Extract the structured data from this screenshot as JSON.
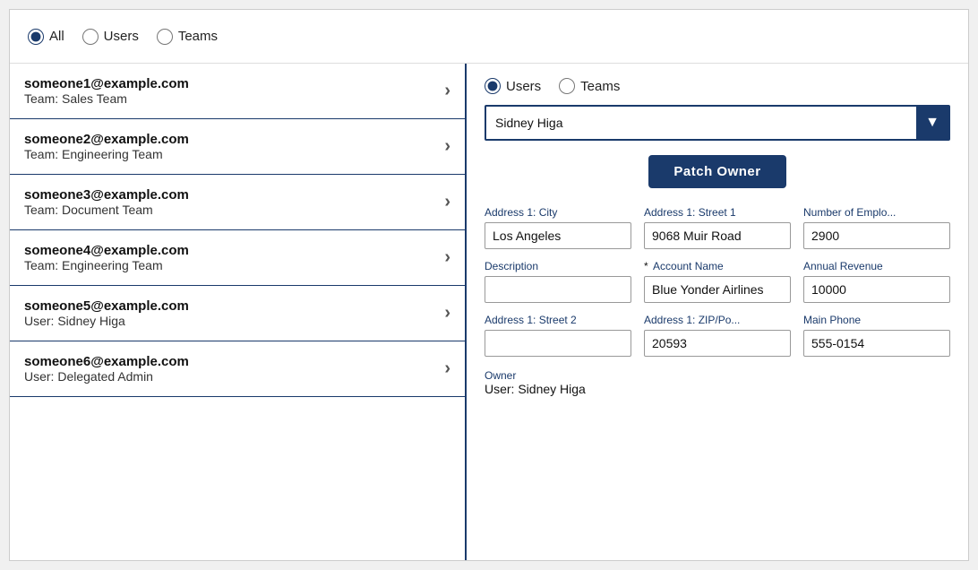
{
  "top_bar": {
    "filter_options": [
      "All",
      "Users",
      "Teams"
    ],
    "selected_filter": "All"
  },
  "list": {
    "items": [
      {
        "email": "someone1@example.com",
        "team": "Team: Sales Team"
      },
      {
        "email": "someone2@example.com",
        "team": "Team: Engineering Team"
      },
      {
        "email": "someone3@example.com",
        "team": "Team: Document Team"
      },
      {
        "email": "someone4@example.com",
        "team": "Team: Engineering Team"
      },
      {
        "email": "someone5@example.com",
        "team": "User: Sidney Higa"
      },
      {
        "email": "someone6@example.com",
        "team": "User: Delegated Admin"
      }
    ]
  },
  "right_panel": {
    "radio_options": [
      "Users",
      "Teams"
    ],
    "selected_radio": "Users",
    "dropdown_value": "Sidney Higa",
    "dropdown_arrow": "▼",
    "patch_owner_label": "Patch Owner",
    "fields": [
      {
        "label": "Address 1: City",
        "value": "Los Angeles",
        "required": false,
        "col": 0
      },
      {
        "label": "Address 1: Street 1",
        "value": "9068 Muir Road",
        "required": false,
        "col": 1
      },
      {
        "label": "Number of Emplo...",
        "value": "2900",
        "required": false,
        "col": 2
      },
      {
        "label": "Description",
        "value": "",
        "required": false,
        "col": 0
      },
      {
        "label": "Account Name",
        "value": "Blue Yonder Airlines",
        "required": true,
        "col": 1
      },
      {
        "label": "Annual Revenue",
        "value": "10000",
        "required": false,
        "col": 2
      },
      {
        "label": "Address 1: Street 2",
        "value": "",
        "required": false,
        "col": 0
      },
      {
        "label": "Address 1: ZIP/Po...",
        "value": "20593",
        "required": false,
        "col": 1
      },
      {
        "label": "Main Phone",
        "value": "555-0154",
        "required": false,
        "col": 2
      }
    ],
    "owner_label": "Owner",
    "owner_value": "User: Sidney Higa"
  }
}
